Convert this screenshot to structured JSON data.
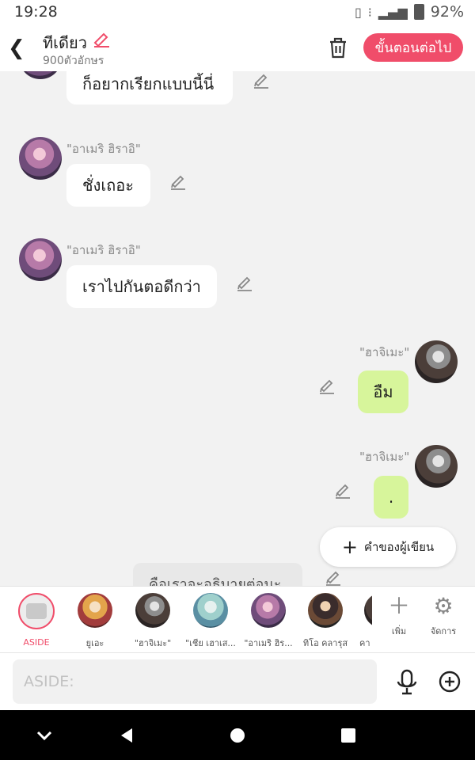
{
  "status": {
    "time": "19:28",
    "battery": "92%"
  },
  "header": {
    "title": "ทีเดียว",
    "subtitle": "900ตัวอักษร",
    "next_label": "ขั้นตอนต่อไป"
  },
  "messages": [
    {
      "text": "ก็อยากเรียกแบบนี้นี่"
    },
    {
      "speaker": "\"อาเมริ ฮิราอิ\"",
      "text": "ชั่งเถอะ"
    },
    {
      "speaker": "\"อาเมริ ฮิราอิ\"",
      "text": "เราไปกันตอดีกว่า"
    },
    {
      "speaker": "\"ฮาจิเมะ\"",
      "text": "อืม"
    },
    {
      "speaker": "\"ฮาจิเมะ\"",
      "text": "."
    },
    {
      "text": "คือเราจะอธิบายต่อนะ"
    }
  ],
  "author_note": {
    "label": "คำของผู้เขียน"
  },
  "characters": [
    {
      "label": "ASIDE"
    },
    {
      "label": "ยูเอะ"
    },
    {
      "label": "\"ฮาจิเมะ\""
    },
    {
      "label": "\"เชีย เฮาเส..."
    },
    {
      "label": "\"อาเมริ ฮิร..."
    },
    {
      "label": "ทิโอ คลารุส"
    },
    {
      "label": "คา"
    }
  ],
  "tools": {
    "add_label": "เพิ่ม",
    "manage_label": "จัดการ"
  },
  "input": {
    "placeholder": "ASIDE:",
    "value": ""
  },
  "colors": {
    "accent": "#f04d6a",
    "my_bubble": "#d7f59b",
    "background": "#f2f2f2"
  }
}
